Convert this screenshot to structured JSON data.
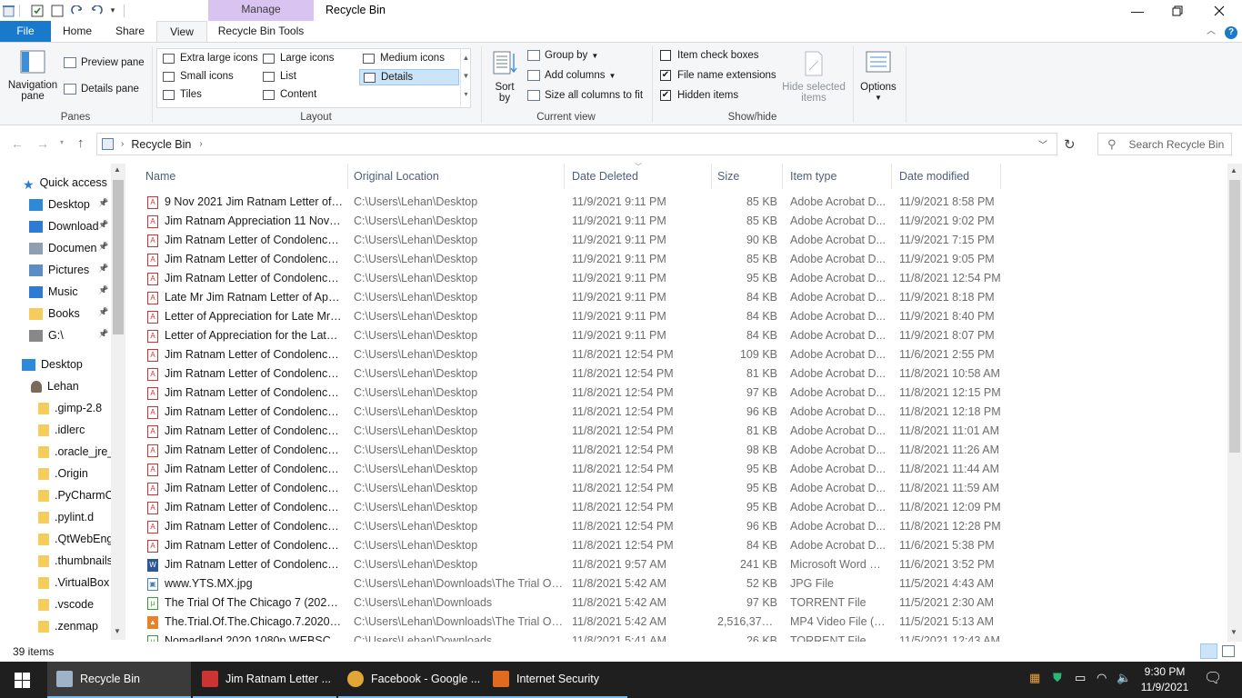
{
  "window": {
    "title": "Recycle Bin",
    "context_tab": "Manage"
  },
  "tabs": {
    "file": "File",
    "home": "Home",
    "share": "Share",
    "view": "View",
    "recycle_bin_tools": "Recycle Bin Tools"
  },
  "ribbon": {
    "panes": {
      "navigation_pane": "Navigation pane",
      "preview_pane": "Preview pane",
      "details_pane": "Details pane",
      "group": "Panes"
    },
    "layout": {
      "extra_large_icons": "Extra large icons",
      "large_icons": "Large icons",
      "medium_icons": "Medium icons",
      "small_icons": "Small icons",
      "list": "List",
      "details": "Details",
      "tiles": "Tiles",
      "content": "Content",
      "group": "Layout"
    },
    "current_view": {
      "sort_by": "Sort by",
      "group_by": "Group by",
      "add_columns": "Add columns",
      "size_all_columns": "Size all columns to fit",
      "group": "Current view"
    },
    "show_hide": {
      "item_check_boxes": "Item check boxes",
      "item_check_boxes_checked": false,
      "file_name_extensions": "File name extensions",
      "file_name_extensions_checked": true,
      "hidden_items": "Hidden items",
      "hidden_items_checked": true,
      "hide_selected_items": "Hide selected items",
      "group": "Show/hide"
    },
    "options": "Options"
  },
  "address": {
    "crumb": "Recycle Bin",
    "search_placeholder": "Search Recycle Bin"
  },
  "nav": {
    "quick_access": "Quick access",
    "items": [
      {
        "label": "Desktop",
        "pinned": true
      },
      {
        "label": "Download",
        "pinned": true
      },
      {
        "label": "Documen",
        "pinned": true
      },
      {
        "label": "Pictures",
        "pinned": true
      },
      {
        "label": "Music",
        "pinned": true
      },
      {
        "label": "Books",
        "pinned": true
      },
      {
        "label": "G:\\",
        "pinned": true
      }
    ],
    "desktop": "Desktop",
    "user": "Lehan",
    "folders": [
      ".gimp-2.8",
      ".idlerc",
      ".oracle_jre_u",
      ".Origin",
      ".PyCharmC",
      ".pylint.d",
      ".QtWebEng",
      ".thumbnails",
      ".VirtualBox",
      ".vscode",
      ".zenmap"
    ]
  },
  "columns": {
    "name": "Name",
    "original_location": "Original Location",
    "date_deleted": "Date Deleted",
    "size": "Size",
    "item_type": "Item type",
    "date_modified": "Date modified"
  },
  "files": [
    {
      "name": "9 Nov 2021 Jim Ratnam Letter of A...",
      "loc": "C:\\Users\\Lehan\\Desktop",
      "deleted": "11/9/2021 9:11 PM",
      "size": "85 KB",
      "type": "Adobe Acrobat D...",
      "modified": "11/9/2021 8:58 PM",
      "icon": "pdf"
    },
    {
      "name": "Jim Ratnam Appreciation 11 Nov 2...",
      "loc": "C:\\Users\\Lehan\\Desktop",
      "deleted": "11/9/2021 9:11 PM",
      "size": "85 KB",
      "type": "Adobe Acrobat D...",
      "modified": "11/9/2021 9:02 PM",
      "icon": "pdf"
    },
    {
      "name": "Jim Ratnam Letter of Condolence....",
      "loc": "C:\\Users\\Lehan\\Desktop",
      "deleted": "11/9/2021 9:11 PM",
      "size": "90 KB",
      "type": "Adobe Acrobat D...",
      "modified": "11/9/2021 7:15 PM",
      "icon": "pdf"
    },
    {
      "name": "Jim Ratnam Letter of Condolences ...",
      "loc": "C:\\Users\\Lehan\\Desktop",
      "deleted": "11/9/2021 9:11 PM",
      "size": "85 KB",
      "type": "Adobe Acrobat D...",
      "modified": "11/9/2021 9:05 PM",
      "icon": "pdf"
    },
    {
      "name": "Jim Ratnam Letter of Condolences....",
      "loc": "C:\\Users\\Lehan\\Desktop",
      "deleted": "11/9/2021 9:11 PM",
      "size": "95 KB",
      "type": "Adobe Acrobat D...",
      "modified": "11/8/2021 12:54 PM",
      "icon": "pdf"
    },
    {
      "name": "Late Mr Jim Ratnam Letter of Appr...",
      "loc": "C:\\Users\\Lehan\\Desktop",
      "deleted": "11/9/2021 9:11 PM",
      "size": "84 KB",
      "type": "Adobe Acrobat D...",
      "modified": "11/9/2021 8:18 PM",
      "icon": "pdf"
    },
    {
      "name": "Letter of Appreciation for Late Mr J...",
      "loc": "C:\\Users\\Lehan\\Desktop",
      "deleted": "11/9/2021 9:11 PM",
      "size": "84 KB",
      "type": "Adobe Acrobat D...",
      "modified": "11/9/2021 8:40 PM",
      "icon": "pdf"
    },
    {
      "name": "Letter of Appreciation for the Late ...",
      "loc": "C:\\Users\\Lehan\\Desktop",
      "deleted": "11/9/2021 9:11 PM",
      "size": "84 KB",
      "type": "Adobe Acrobat D...",
      "modified": "11/9/2021 8:07 PM",
      "icon": "pdf"
    },
    {
      "name": "Jim Ratnam Letter of Condolences....",
      "loc": "C:\\Users\\Lehan\\Desktop",
      "deleted": "11/8/2021 12:54 PM",
      "size": "109 KB",
      "type": "Adobe Acrobat D...",
      "modified": "11/6/2021 2:55 PM",
      "icon": "pdf"
    },
    {
      "name": "Jim Ratnam Letter of Condolences ...",
      "loc": "C:\\Users\\Lehan\\Desktop",
      "deleted": "11/8/2021 12:54 PM",
      "size": "81 KB",
      "type": "Adobe Acrobat D...",
      "modified": "11/8/2021 10:58 AM",
      "icon": "pdf"
    },
    {
      "name": "Jim Ratnam Letter of Condolences ...",
      "loc": "C:\\Users\\Lehan\\Desktop",
      "deleted": "11/8/2021 12:54 PM",
      "size": "97 KB",
      "type": "Adobe Acrobat D...",
      "modified": "11/8/2021 12:15 PM",
      "icon": "pdf"
    },
    {
      "name": "Jim Ratnam Letter of Condolences ...",
      "loc": "C:\\Users\\Lehan\\Desktop",
      "deleted": "11/8/2021 12:54 PM",
      "size": "96 KB",
      "type": "Adobe Acrobat D...",
      "modified": "11/8/2021 12:18 PM",
      "icon": "pdf"
    },
    {
      "name": "Jim Ratnam Letter of Condolences ...",
      "loc": "C:\\Users\\Lehan\\Desktop",
      "deleted": "11/8/2021 12:54 PM",
      "size": "81 KB",
      "type": "Adobe Acrobat D...",
      "modified": "11/8/2021 11:01 AM",
      "icon": "pdf"
    },
    {
      "name": "Jim Ratnam Letter of Condolences ...",
      "loc": "C:\\Users\\Lehan\\Desktop",
      "deleted": "11/8/2021 12:54 PM",
      "size": "98 KB",
      "type": "Adobe Acrobat D...",
      "modified": "11/8/2021 11:26 AM",
      "icon": "pdf"
    },
    {
      "name": "Jim Ratnam Letter of Condolences ...",
      "loc": "C:\\Users\\Lehan\\Desktop",
      "deleted": "11/8/2021 12:54 PM",
      "size": "95 KB",
      "type": "Adobe Acrobat D...",
      "modified": "11/8/2021 11:44 AM",
      "icon": "pdf"
    },
    {
      "name": "Jim Ratnam Letter of Condolences ...",
      "loc": "C:\\Users\\Lehan\\Desktop",
      "deleted": "11/8/2021 12:54 PM",
      "size": "95 KB",
      "type": "Adobe Acrobat D...",
      "modified": "11/8/2021 11:59 AM",
      "icon": "pdf"
    },
    {
      "name": "Jim Ratnam Letter of Condolences ...",
      "loc": "C:\\Users\\Lehan\\Desktop",
      "deleted": "11/8/2021 12:54 PM",
      "size": "95 KB",
      "type": "Adobe Acrobat D...",
      "modified": "11/8/2021 12:09 PM",
      "icon": "pdf"
    },
    {
      "name": "Jim Ratnam Letter of Condolences ...",
      "loc": "C:\\Users\\Lehan\\Desktop",
      "deleted": "11/8/2021 12:54 PM",
      "size": "96 KB",
      "type": "Adobe Acrobat D...",
      "modified": "11/8/2021 12:28 PM",
      "icon": "pdf"
    },
    {
      "name": "Jim Ratnam Letter of Condolences ...",
      "loc": "C:\\Users\\Lehan\\Desktop",
      "deleted": "11/8/2021 12:54 PM",
      "size": "84 KB",
      "type": "Adobe Acrobat D...",
      "modified": "11/6/2021 5:38 PM",
      "icon": "pdf"
    },
    {
      "name": "Jim Ratnam Letter of Condolences....",
      "loc": "C:\\Users\\Lehan\\Desktop",
      "deleted": "11/8/2021 9:57 AM",
      "size": "241 KB",
      "type": "Microsoft Word D...",
      "modified": "11/6/2021 3:52 PM",
      "icon": "word"
    },
    {
      "name": "www.YTS.MX.jpg",
      "loc": "C:\\Users\\Lehan\\Downloads\\The Trial Of ...",
      "deleted": "11/8/2021 5:42 AM",
      "size": "52 KB",
      "type": "JPG File",
      "modified": "11/5/2021 4:43 AM",
      "icon": "jpg"
    },
    {
      "name": "The Trial Of The Chicago 7 (2020) [1...",
      "loc": "C:\\Users\\Lehan\\Downloads",
      "deleted": "11/8/2021 5:42 AM",
      "size": "97 KB",
      "type": "TORRENT File",
      "modified": "11/5/2021 2:30 AM",
      "icon": "torrent"
    },
    {
      "name": "The.Trial.Of.The.Chicago.7.2020.108...",
      "loc": "C:\\Users\\Lehan\\Downloads\\The Trial Of ...",
      "deleted": "11/8/2021 5:42 AM",
      "size": "2,516,371 KB",
      "type": "MP4 Video File (V...",
      "modified": "11/5/2021 5:13 AM",
      "icon": "vlc"
    },
    {
      "name": "Nomadland.2020.1080p.WEBSCR.D...",
      "loc": "C:\\Users\\Lehan\\Downloads",
      "deleted": "11/8/2021 5:41 AM",
      "size": "26 KB",
      "type": "TORRENT File",
      "modified": "11/5/2021 12:43 AM",
      "icon": "torrent"
    }
  ],
  "status": {
    "count": "39 items"
  },
  "taskbar": {
    "apps": [
      {
        "label": "Recycle Bin",
        "active": true
      },
      {
        "label": "Jim Ratnam Letter ...",
        "active": false
      },
      {
        "label": "Facebook - Google ...",
        "active": false
      },
      {
        "label": "Internet Security",
        "active": false
      }
    ],
    "time": "9:30 PM",
    "date": "11/9/2021"
  }
}
